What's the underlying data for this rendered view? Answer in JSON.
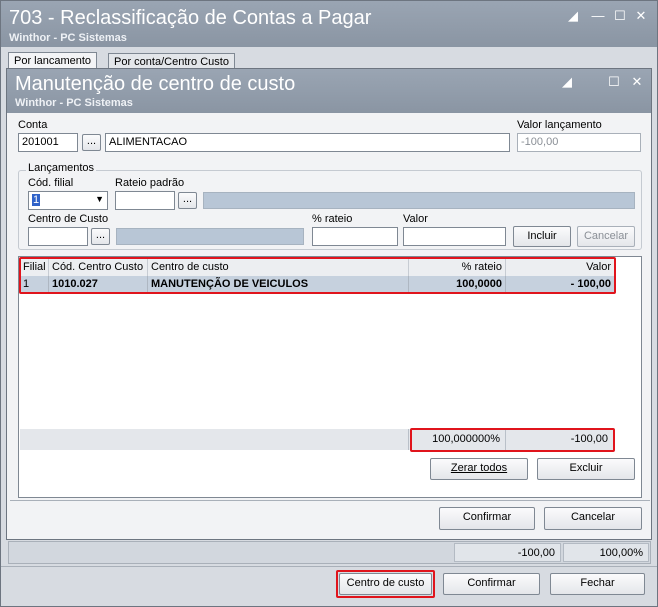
{
  "outer_window": {
    "title": "703 - Reclassificação de Contas a Pagar",
    "subtitle": "Winthor - PC Sistemas",
    "tabs": [
      {
        "label": "Por lancamento"
      },
      {
        "label": "Por conta/Centro Custo"
      }
    ]
  },
  "dialog": {
    "title": "Manutenção de centro de custo",
    "subtitle": "Winthor - PC Sistemas",
    "conta_label": "Conta",
    "conta_code": "201001",
    "conta_name": "ALIMENTACAO",
    "valor_lancamento_label": "Valor lançamento",
    "valor_lancamento": "-100,00",
    "lancamentos_label": "Lançamentos",
    "cod_filial_label": "Cód. filial",
    "cod_filial_value": "1",
    "rateio_padrao_label": "Rateio padrão",
    "centro_custo_label": "Centro de Custo",
    "perc_rateio_label": "% rateio",
    "valor_label": "Valor",
    "dots_label": "...",
    "incluir_label": "Incluir",
    "cancelar_inline_label": "Cancelar",
    "grid": {
      "headers": [
        "Filial",
        "Cód. Centro Custo",
        "Centro de custo",
        "% rateio",
        "Valor"
      ],
      "rows": [
        [
          "1",
          "1010.027",
          "MANUTENÇÃO DE VEICULOS",
          "100,0000",
          "- 100,00"
        ]
      ],
      "footer_percent": "100,000000%",
      "footer_value": "-100,00"
    },
    "zerar_todos_label": "Zerar todos",
    "excluir_label": "Excluir",
    "confirmar_label": "Confirmar",
    "cancelar_label": "Cancelar"
  },
  "status_bar": {
    "value": "-100,00",
    "percent": "100,00%"
  },
  "bottom_buttons": {
    "centro_custo": "Centro de custo",
    "confirmar": "Confirmar",
    "fechar": "Fechar"
  }
}
